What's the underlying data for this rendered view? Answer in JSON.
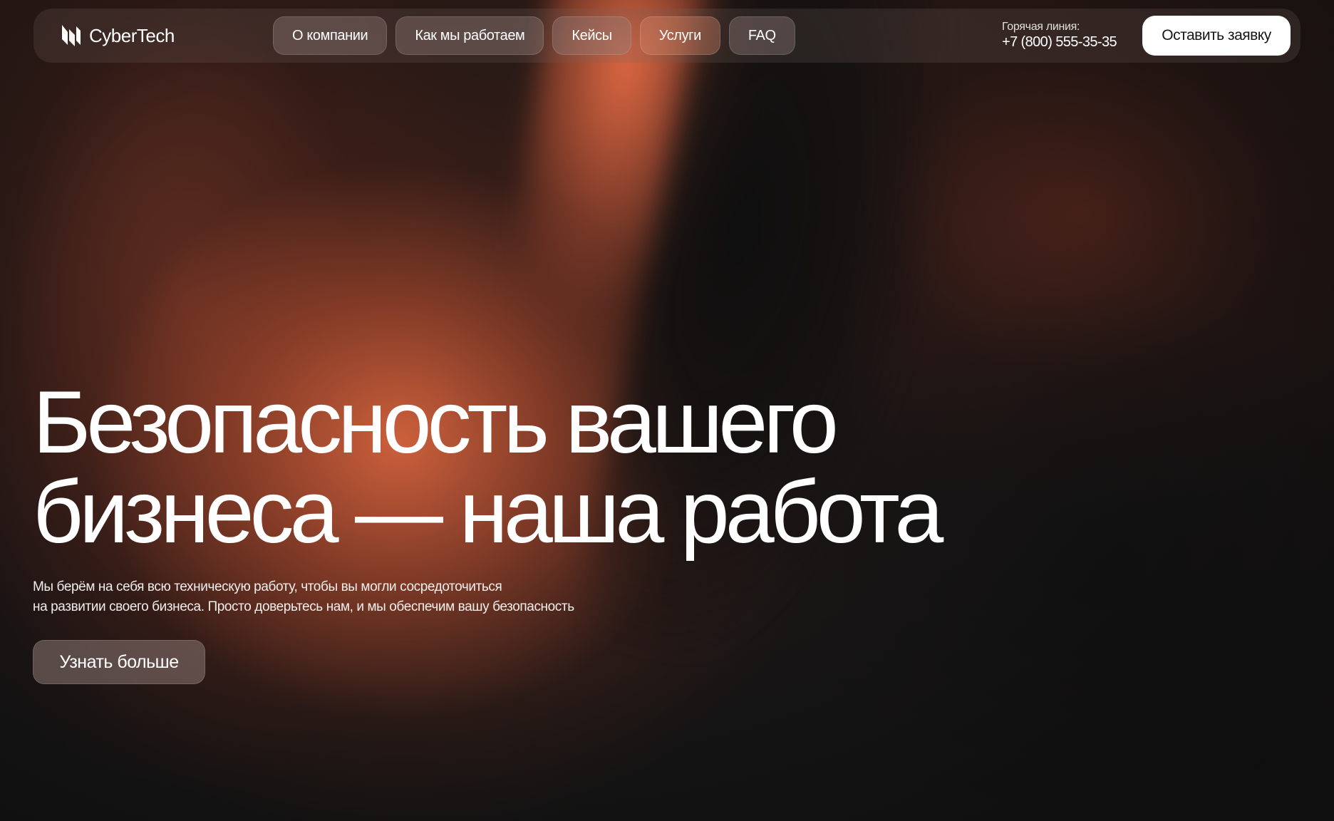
{
  "brand": {
    "name": "CyberTech",
    "logo_icon": "cybertech-logo-icon"
  },
  "nav": {
    "items": [
      {
        "label": "О компании"
      },
      {
        "label": "Как мы работаем"
      },
      {
        "label": "Кейсы"
      },
      {
        "label": "Услуги"
      },
      {
        "label": "FAQ"
      }
    ]
  },
  "hotline": {
    "label": "Горячая линия:",
    "phone": "+7 (800) 555-35-35"
  },
  "header": {
    "cta_label": "Оставить заявку"
  },
  "hero": {
    "title_line1": "Безопасность вашего",
    "title_line2": "бизнеса — наша работа",
    "subtitle_line1": "Мы берём на себя всю техническую работу, чтобы вы могли сосредоточиться",
    "subtitle_line2": "на развитии своего бизнеса. Просто доверьтесь нам, и мы обеспечим вашу безопасность",
    "button_label": "Узнать больше"
  },
  "colors": {
    "background": "#161616",
    "accent_glow": "#d6643e",
    "cta_background": "#ffffff",
    "text": "#ffffff"
  }
}
